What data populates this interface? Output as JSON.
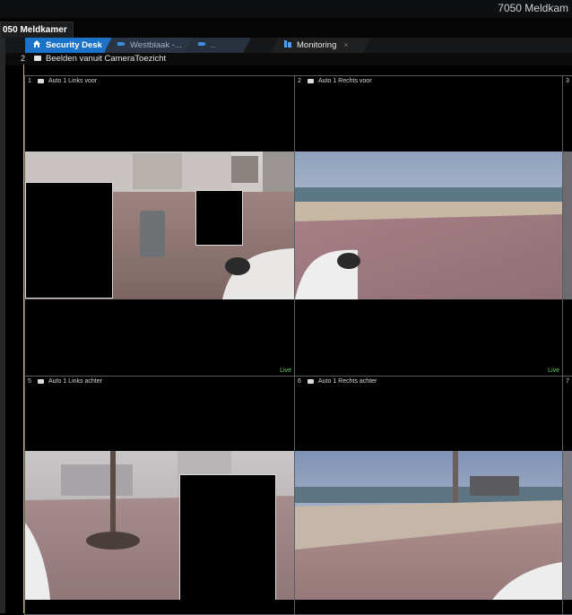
{
  "window": {
    "title": "7050 Meldkam"
  },
  "monitor_tab": {
    "label": "050 Meldkamer"
  },
  "tabs": [
    {
      "label": "Security Desk",
      "icon": "home-icon"
    },
    {
      "label": "Westblaak -...",
      "icon": "camera-icon"
    },
    {
      "label": "..",
      "icon": "camera-icon"
    },
    {
      "label": "Monitoring",
      "icon": "monitoring-icon",
      "close": "×"
    }
  ],
  "header": {
    "number": "2",
    "label": "Beelden vanuit CameraToezicht"
  },
  "tiles": [
    {
      "number": "1",
      "label": "Auto 1 Links voor",
      "live": "Live"
    },
    {
      "number": "2",
      "label": "Auto 1 Rechts voor",
      "live": "Live"
    },
    {
      "number": "3"
    },
    {
      "number": "5",
      "label": "Auto 1 Links achter"
    },
    {
      "number": "6",
      "label": "Auto 1 Rechts achter"
    },
    {
      "number": "7"
    }
  ],
  "colors": {
    "accent_tab": "#1a73c9",
    "live": "#5fd35f",
    "active_border": "#c9b93a"
  }
}
